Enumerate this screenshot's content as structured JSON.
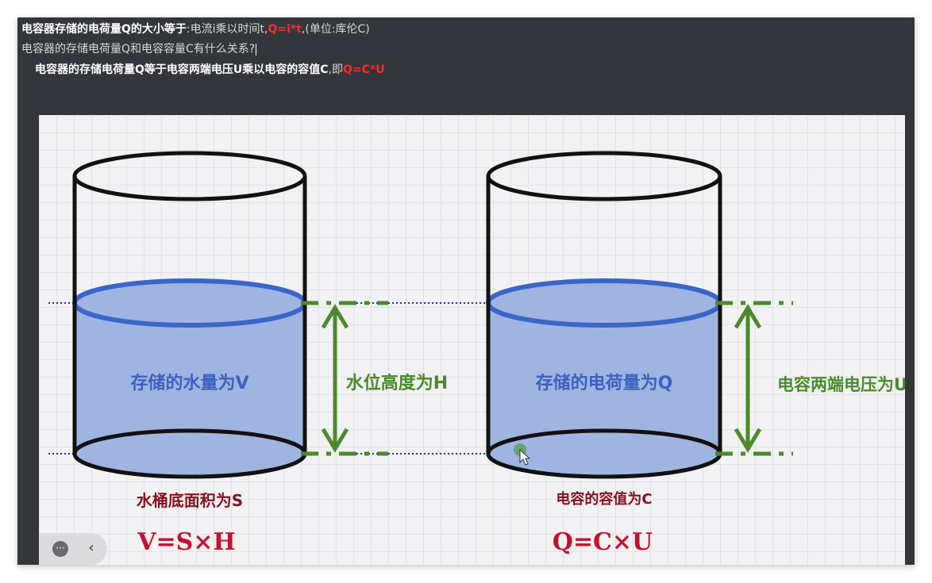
{
  "notes": {
    "line1": {
      "bold": "电容器存储的电荷量Q的大小等于",
      "plain": ":电流i乘以时间t,",
      "formula": "Q=i*t",
      "unit": ",(单位:库伦C)"
    },
    "line2": {
      "text": "电容器的存储电荷量Q和电容容量C有什么关系?"
    },
    "line3": {
      "bold": "电容器的存储电荷量Q等于电容两端电压U乘以电容的容值C",
      "plain": ",即",
      "formula": "Q=C*U"
    }
  },
  "slide": {
    "left": {
      "volume_label": "存储的水量为V",
      "height_label": "水位高度为H",
      "base_label": "水桶底面积为S",
      "formula": "V=S×H"
    },
    "right": {
      "volume_label": "存储的电荷量为Q",
      "height_label": "电容两端电压为U",
      "base_label": "电容的容值为C",
      "formula": "Q=C×U"
    }
  },
  "controls": {
    "more_glyph": "···",
    "back_glyph": "‹"
  },
  "colors": {
    "panel_bg": "#33373b",
    "formula_red": "#ff2a2a",
    "water_fill": "#9fb4e0",
    "water_outline": "#3a66c8",
    "arrow_green": "#4b8a2a",
    "label_blue": "#3a62c0",
    "label_darkred": "#8b1020",
    "formula_crimson": "#c8102e",
    "dotted_blue": "#2a2aa8"
  }
}
